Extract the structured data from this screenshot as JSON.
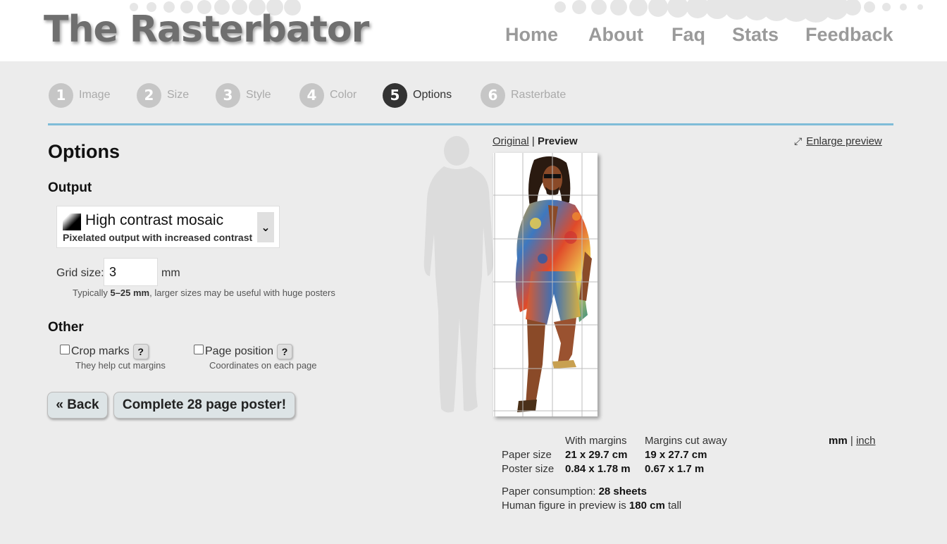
{
  "header": {
    "logo": "The Rasterbator",
    "nav": [
      "Home",
      "About",
      "Faq",
      "Stats",
      "Feedback"
    ]
  },
  "steps": [
    {
      "num": "1",
      "label": "Image",
      "active": false
    },
    {
      "num": "2",
      "label": "Size",
      "active": false
    },
    {
      "num": "3",
      "label": "Style",
      "active": false
    },
    {
      "num": "4",
      "label": "Color",
      "active": false
    },
    {
      "num": "5",
      "label": "Options",
      "active": true
    },
    {
      "num": "6",
      "label": "Rasterbate",
      "active": false
    }
  ],
  "options": {
    "title": "Options",
    "output_heading": "Output",
    "output_select": {
      "title": "High contrast mosaic",
      "subtitle": "Pixelated output with increased contrast",
      "arrow": "⌄"
    },
    "grid_label": "Grid size:",
    "grid_value": "3",
    "grid_unit": "mm",
    "hint_pre": "Typically ",
    "hint_bold": "5–25 mm",
    "hint_post": ", larger sizes may be useful with huge posters",
    "other_heading": "Other",
    "crop_marks_label": "Crop marks",
    "crop_marks_hint": "They help cut margins",
    "page_position_label": "Page position",
    "page_position_hint": "Coordinates on each page",
    "help_glyph": "?",
    "back_button": "« Back",
    "complete_button": "Complete 28 page poster!"
  },
  "preview": {
    "original_link": "Original",
    "separator": "|",
    "preview_label": "Preview",
    "enlarge_icon": "⤢",
    "enlarge_label": "Enlarge preview"
  },
  "info": {
    "col_with_margins": "With margins",
    "col_margins_cut": "Margins cut away",
    "paper_size_label": "Paper size",
    "paper_size_with": "21 x 29.7 cm",
    "paper_size_cut": "19 x 27.7 cm",
    "poster_size_label": "Poster size",
    "poster_size_with": "0.84 x 1.78 m",
    "poster_size_cut": "0.67 x 1.7 m",
    "unit_mm": "mm",
    "unit_sep": "|",
    "unit_inch": "inch",
    "consumption_label": "Paper consumption: ",
    "consumption_value": "28 sheets",
    "figure_pre": "Human figure in preview is ",
    "figure_value": "180 cm",
    "figure_post": " tall"
  }
}
